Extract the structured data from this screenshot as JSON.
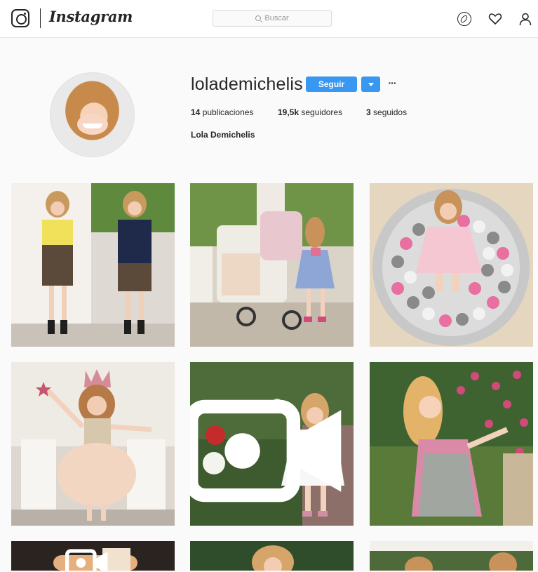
{
  "header": {
    "logo_text": "Instagram",
    "search_placeholder": "Buscar",
    "nav_icons": [
      "compass-icon",
      "heart-icon",
      "person-icon"
    ]
  },
  "profile": {
    "username": "lolademichelis",
    "follow_label": "Seguir",
    "more_label": "···",
    "stats": {
      "posts_count": "14",
      "posts_label": "publicaciones",
      "followers_count": "19,5k",
      "followers_label": "seguidores",
      "following_count": "3",
      "following_label": "seguidos"
    },
    "full_name": "Lola Demichelis"
  },
  "posts": [
    {
      "scene": "school-uniforms",
      "video": false
    },
    {
      "scene": "stroller",
      "video": false
    },
    {
      "scene": "ball-pit",
      "video": false
    },
    {
      "scene": "princess-crown",
      "video": false
    },
    {
      "scene": "garden-dress",
      "video": true
    },
    {
      "scene": "flower-bush",
      "video": false
    },
    {
      "scene": "partial-1",
      "video": true
    },
    {
      "scene": "partial-2",
      "video": false
    },
    {
      "scene": "partial-3",
      "video": false
    }
  ],
  "colors": {
    "accent": "#3897f0",
    "text": "#262626",
    "background": "#fafafa"
  }
}
